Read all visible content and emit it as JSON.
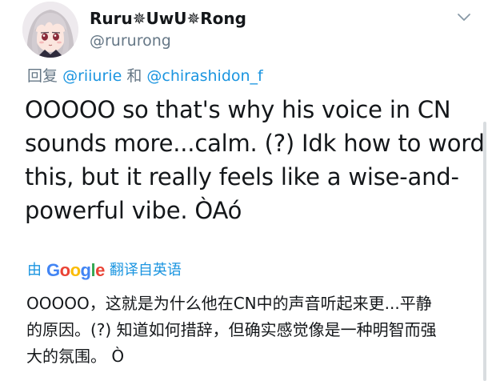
{
  "user": {
    "display_name": "Ruru✵UwU✵Rong",
    "handle": "@rururong"
  },
  "reply": {
    "prefix": "回复",
    "mention_1": "@riiurie",
    "and_text": "和",
    "mention_2": "@chirashidon_f"
  },
  "tweet": {
    "lines": [
      "OOOOO so that's why his voice in CN",
      "sounds more...calm. (?) Idk how to word",
      "this, but it really feels like a wise-and-",
      "powerful vibe. ÒAó"
    ]
  },
  "translation": {
    "by_label": "由",
    "google": {
      "letters": [
        "G",
        "o",
        "o",
        "g",
        "l",
        "e"
      ],
      "colors": [
        "#4285f4",
        "#ea4335",
        "#fbbc05",
        "#4285f4",
        "#34a853",
        "#ea4335"
      ]
    },
    "from_label": "翻译自英语",
    "lines": [
      "OOOOO，这就是为什么他在CN中的声音听起来更...平静",
      "的原因。(?) 知道如何措辞，但确实感觉像是一种明智而强",
      "大的氛围。 Ò"
    ]
  },
  "colors": {
    "text": "#14171a",
    "secondary": "#657786",
    "link": "#1b95e0"
  },
  "icons": {
    "avatar": "anime-girl-avatar",
    "menu": "chevron-down-icon"
  }
}
